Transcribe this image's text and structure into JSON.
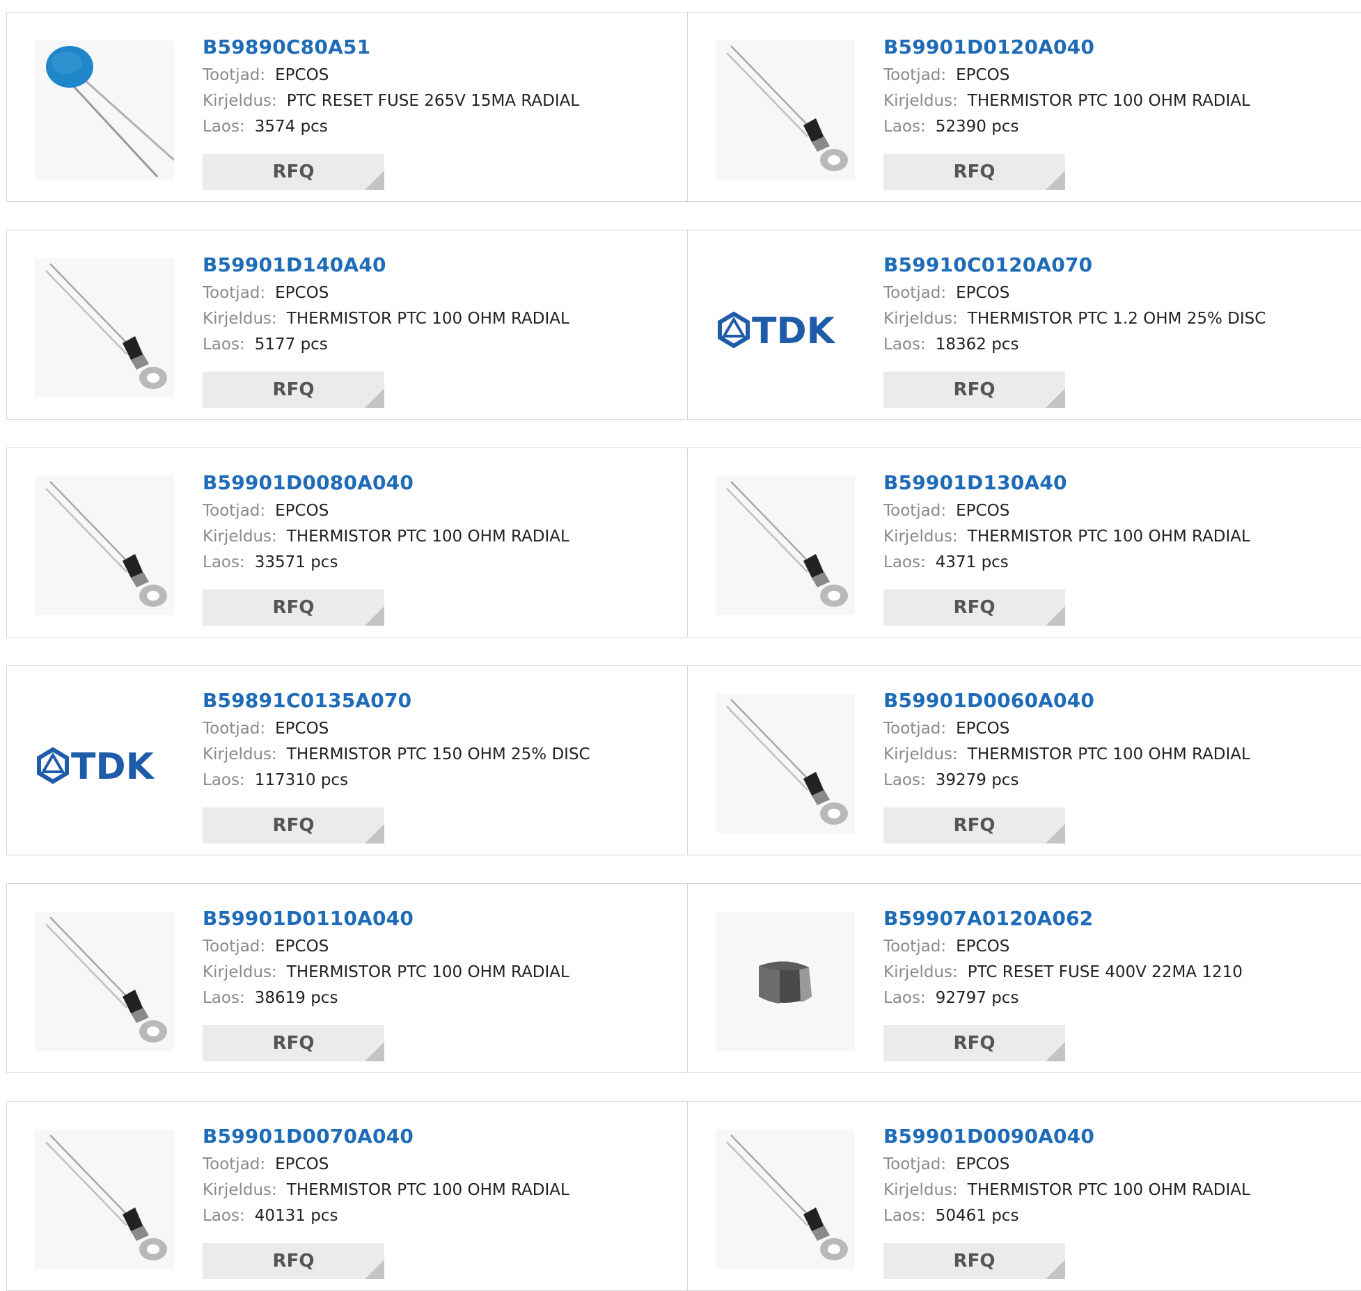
{
  "labels": {
    "manufacturer": "Tootjad:",
    "description": "Kirjeldus:",
    "stock": "Laos:",
    "rfq": "RFQ"
  },
  "brand": {
    "tdk_logo_text": "TDK",
    "tdk_color": "#1e5ba8"
  },
  "colors": {
    "part_link": "#1e6bb8",
    "rfq_bg": "#ebebeb"
  },
  "products": [
    {
      "part": "B59890C80A51",
      "manufacturer": "EPCOS",
      "description": "PTC RESET FUSE 265V 15MA RADIAL",
      "stock": "3574 pcs",
      "image": "disc-thermistor-icon"
    },
    {
      "part": "B59901D0120A040",
      "manufacturer": "EPCOS",
      "description": "THERMISTOR PTC 100 OHM RADIAL",
      "stock": "52390 pcs",
      "image": "ring-lug-thermistor-icon"
    },
    {
      "part": "B59901D140A40",
      "manufacturer": "EPCOS",
      "description": "THERMISTOR PTC 100 OHM RADIAL",
      "stock": "5177 pcs",
      "image": "ring-lug-thermistor-icon"
    },
    {
      "part": "B59910C0120A070",
      "manufacturer": "EPCOS",
      "description": "THERMISTOR PTC 1.2 OHM 25% DISC",
      "stock": "18362 pcs",
      "image": "tdk-logo"
    },
    {
      "part": "B59901D0080A040",
      "manufacturer": "EPCOS",
      "description": "THERMISTOR PTC 100 OHM RADIAL",
      "stock": "33571 pcs",
      "image": "ring-lug-thermistor-icon"
    },
    {
      "part": "B59901D130A40",
      "manufacturer": "EPCOS",
      "description": "THERMISTOR PTC 100 OHM RADIAL",
      "stock": "4371 pcs",
      "image": "ring-lug-thermistor-icon"
    },
    {
      "part": "B59891C0135A070",
      "manufacturer": "EPCOS",
      "description": "THERMISTOR PTC 150 OHM 25% DISC",
      "stock": "117310 pcs",
      "image": "tdk-logo"
    },
    {
      "part": "B59901D0060A040",
      "manufacturer": "EPCOS",
      "description": "THERMISTOR PTC 100 OHM RADIAL",
      "stock": "39279 pcs",
      "image": "ring-lug-thermistor-icon"
    },
    {
      "part": "B59901D0110A040",
      "manufacturer": "EPCOS",
      "description": "THERMISTOR PTC 100 OHM RADIAL",
      "stock": "38619 pcs",
      "image": "ring-lug-thermistor-icon"
    },
    {
      "part": "B59907A0120A062",
      "manufacturer": "EPCOS",
      "description": "PTC RESET FUSE 400V 22MA 1210",
      "stock": "92797 pcs",
      "image": "smd-chip-icon"
    },
    {
      "part": "B59901D0070A040",
      "manufacturer": "EPCOS",
      "description": "THERMISTOR PTC 100 OHM RADIAL",
      "stock": "40131 pcs",
      "image": "ring-lug-thermistor-icon"
    },
    {
      "part": "B59901D0090A040",
      "manufacturer": "EPCOS",
      "description": "THERMISTOR PTC 100 OHM RADIAL",
      "stock": "50461 pcs",
      "image": "ring-lug-thermistor-icon"
    }
  ]
}
